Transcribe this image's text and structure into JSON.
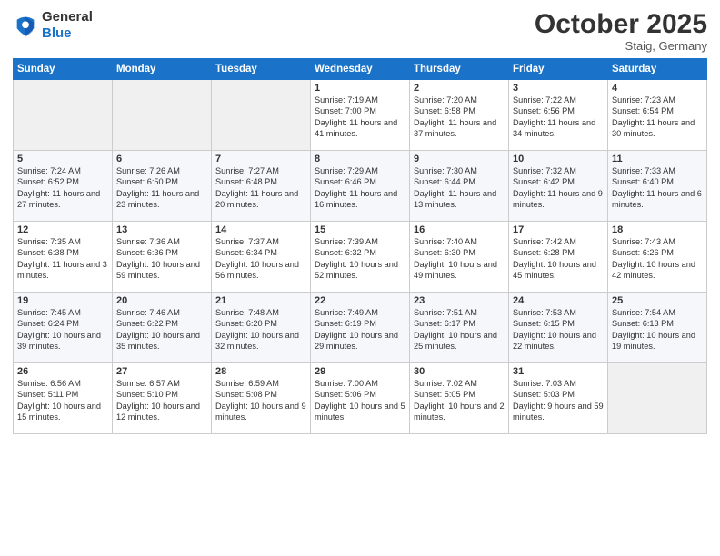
{
  "logo": {
    "line1": "General",
    "line2": "Blue"
  },
  "title": "October 2025",
  "location": "Staig, Germany",
  "days_header": [
    "Sunday",
    "Monday",
    "Tuesday",
    "Wednesday",
    "Thursday",
    "Friday",
    "Saturday"
  ],
  "weeks": [
    [
      {
        "num": "",
        "info": ""
      },
      {
        "num": "",
        "info": ""
      },
      {
        "num": "",
        "info": ""
      },
      {
        "num": "1",
        "info": "Sunrise: 7:19 AM\nSunset: 7:00 PM\nDaylight: 11 hours\nand 41 minutes."
      },
      {
        "num": "2",
        "info": "Sunrise: 7:20 AM\nSunset: 6:58 PM\nDaylight: 11 hours\nand 37 minutes."
      },
      {
        "num": "3",
        "info": "Sunrise: 7:22 AM\nSunset: 6:56 PM\nDaylight: 11 hours\nand 34 minutes."
      },
      {
        "num": "4",
        "info": "Sunrise: 7:23 AM\nSunset: 6:54 PM\nDaylight: 11 hours\nand 30 minutes."
      }
    ],
    [
      {
        "num": "5",
        "info": "Sunrise: 7:24 AM\nSunset: 6:52 PM\nDaylight: 11 hours\nand 27 minutes."
      },
      {
        "num": "6",
        "info": "Sunrise: 7:26 AM\nSunset: 6:50 PM\nDaylight: 11 hours\nand 23 minutes."
      },
      {
        "num": "7",
        "info": "Sunrise: 7:27 AM\nSunset: 6:48 PM\nDaylight: 11 hours\nand 20 minutes."
      },
      {
        "num": "8",
        "info": "Sunrise: 7:29 AM\nSunset: 6:46 PM\nDaylight: 11 hours\nand 16 minutes."
      },
      {
        "num": "9",
        "info": "Sunrise: 7:30 AM\nSunset: 6:44 PM\nDaylight: 11 hours\nand 13 minutes."
      },
      {
        "num": "10",
        "info": "Sunrise: 7:32 AM\nSunset: 6:42 PM\nDaylight: 11 hours\nand 9 minutes."
      },
      {
        "num": "11",
        "info": "Sunrise: 7:33 AM\nSunset: 6:40 PM\nDaylight: 11 hours\nand 6 minutes."
      }
    ],
    [
      {
        "num": "12",
        "info": "Sunrise: 7:35 AM\nSunset: 6:38 PM\nDaylight: 11 hours\nand 3 minutes."
      },
      {
        "num": "13",
        "info": "Sunrise: 7:36 AM\nSunset: 6:36 PM\nDaylight: 10 hours\nand 59 minutes."
      },
      {
        "num": "14",
        "info": "Sunrise: 7:37 AM\nSunset: 6:34 PM\nDaylight: 10 hours\nand 56 minutes."
      },
      {
        "num": "15",
        "info": "Sunrise: 7:39 AM\nSunset: 6:32 PM\nDaylight: 10 hours\nand 52 minutes."
      },
      {
        "num": "16",
        "info": "Sunrise: 7:40 AM\nSunset: 6:30 PM\nDaylight: 10 hours\nand 49 minutes."
      },
      {
        "num": "17",
        "info": "Sunrise: 7:42 AM\nSunset: 6:28 PM\nDaylight: 10 hours\nand 45 minutes."
      },
      {
        "num": "18",
        "info": "Sunrise: 7:43 AM\nSunset: 6:26 PM\nDaylight: 10 hours\nand 42 minutes."
      }
    ],
    [
      {
        "num": "19",
        "info": "Sunrise: 7:45 AM\nSunset: 6:24 PM\nDaylight: 10 hours\nand 39 minutes."
      },
      {
        "num": "20",
        "info": "Sunrise: 7:46 AM\nSunset: 6:22 PM\nDaylight: 10 hours\nand 35 minutes."
      },
      {
        "num": "21",
        "info": "Sunrise: 7:48 AM\nSunset: 6:20 PM\nDaylight: 10 hours\nand 32 minutes."
      },
      {
        "num": "22",
        "info": "Sunrise: 7:49 AM\nSunset: 6:19 PM\nDaylight: 10 hours\nand 29 minutes."
      },
      {
        "num": "23",
        "info": "Sunrise: 7:51 AM\nSunset: 6:17 PM\nDaylight: 10 hours\nand 25 minutes."
      },
      {
        "num": "24",
        "info": "Sunrise: 7:53 AM\nSunset: 6:15 PM\nDaylight: 10 hours\nand 22 minutes."
      },
      {
        "num": "25",
        "info": "Sunrise: 7:54 AM\nSunset: 6:13 PM\nDaylight: 10 hours\nand 19 minutes."
      }
    ],
    [
      {
        "num": "26",
        "info": "Sunrise: 6:56 AM\nSunset: 5:11 PM\nDaylight: 10 hours\nand 15 minutes."
      },
      {
        "num": "27",
        "info": "Sunrise: 6:57 AM\nSunset: 5:10 PM\nDaylight: 10 hours\nand 12 minutes."
      },
      {
        "num": "28",
        "info": "Sunrise: 6:59 AM\nSunset: 5:08 PM\nDaylight: 10 hours\nand 9 minutes."
      },
      {
        "num": "29",
        "info": "Sunrise: 7:00 AM\nSunset: 5:06 PM\nDaylight: 10 hours\nand 5 minutes."
      },
      {
        "num": "30",
        "info": "Sunrise: 7:02 AM\nSunset: 5:05 PM\nDaylight: 10 hours\nand 2 minutes."
      },
      {
        "num": "31",
        "info": "Sunrise: 7:03 AM\nSunset: 5:03 PM\nDaylight: 9 hours\nand 59 minutes."
      },
      {
        "num": "",
        "info": ""
      }
    ]
  ]
}
